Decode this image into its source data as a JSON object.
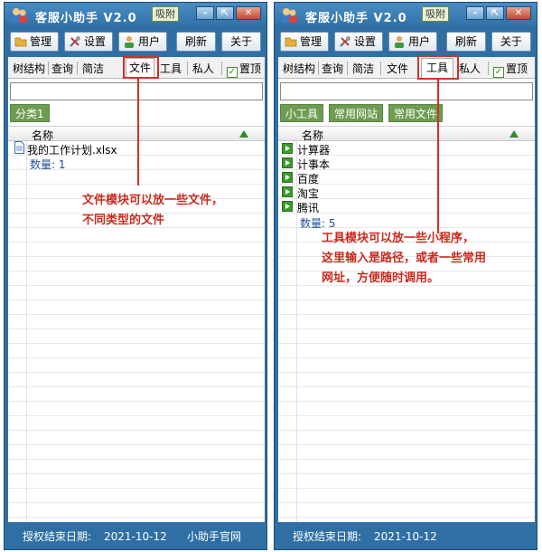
{
  "left_window": {
    "title": "客服小助手 V2.0",
    "attach_label": "吸附",
    "toolbar": {
      "manage": "管理",
      "settings": "设置",
      "user": "用户",
      "refresh": "刷新",
      "about": "关于"
    },
    "tabs": [
      "树结构",
      "查询",
      "简洁",
      "文件",
      "工具",
      "私人"
    ],
    "active_tab": "文件",
    "pin_label": "置顶",
    "categories": [
      "分类1"
    ],
    "column_name": "名称",
    "items": [
      "我的工作计划.xlsx"
    ],
    "count_label": "数量: 1",
    "annotation": [
      "文件模块可以放一些文件，",
      "不同类型的文件"
    ],
    "status": {
      "expiry_label": "授权结束日期:",
      "expiry_date": "2021-10-12",
      "site": "小助手官网"
    }
  },
  "right_window": {
    "title": "客服小助手 V2.0",
    "attach_label": "吸附",
    "toolbar": {
      "manage": "管理",
      "settings": "设置",
      "user": "用户",
      "refresh": "刷新",
      "about": "关于"
    },
    "tabs": [
      "树结构",
      "查询",
      "简洁",
      "文件",
      "工具",
      "私人"
    ],
    "active_tab": "工具",
    "pin_label": "置顶",
    "categories": [
      "小工具",
      "常用网站",
      "常用文件"
    ],
    "column_name": "名称",
    "items": [
      "计算器",
      "计事本",
      "百度",
      "淘宝",
      "腾讯"
    ],
    "count_label": "数量: 5",
    "annotation": [
      "工具模块可以放一些小程序，",
      "这里输入是路径，或者一些常用",
      "网址，方便随时调用。"
    ],
    "status": {
      "expiry_label": "授权结束日期:",
      "expiry_date": "2021-10-12"
    }
  },
  "colors": {
    "frame": "#2f6fa4",
    "category": "#6e9c52",
    "annotation": "#c92a1e",
    "count": "#1f4f96"
  }
}
